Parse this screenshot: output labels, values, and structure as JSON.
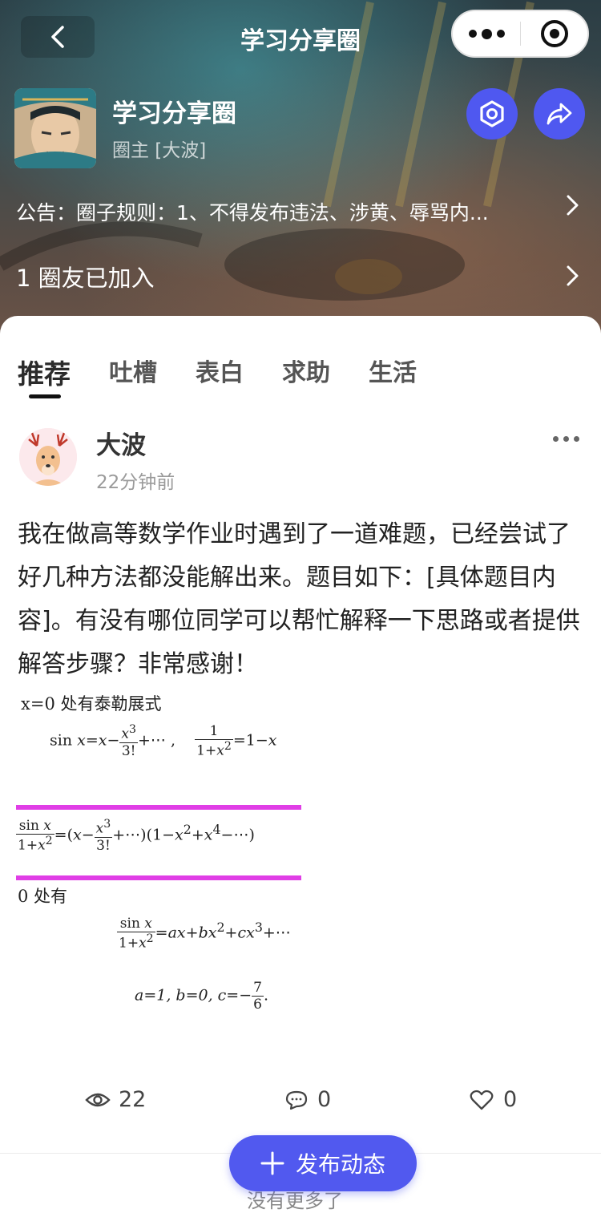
{
  "nav": {
    "title": "学习分享圈"
  },
  "circle": {
    "name": "学习分享圈",
    "owner": "圈主 [大波]",
    "notice": "公告：圈子规则：1、不得发布违法、涉黄、辱骂内...",
    "members": "1 圈友已加入"
  },
  "tabs": [
    {
      "label": "推荐",
      "active": true
    },
    {
      "label": "吐槽"
    },
    {
      "label": "表白"
    },
    {
      "label": "求助"
    },
    {
      "label": "生活"
    }
  ],
  "post": {
    "author": "大波",
    "time": "22分钟前",
    "text": "我在做高等数学作业时遇到了一道难题，已经尝试了好几种方法都没能解出来。题目如下：[具体题目内容]。有没有哪位同学可以帮忙解释一下思路或者提供解答步骤？非常感谢！",
    "math": {
      "line1": "x=0 处有泰勒展式",
      "line4": "0 处有",
      "result": "a=1, b=0, c=−"
    },
    "views": "22",
    "comments": "0",
    "likes": "0"
  },
  "fab": {
    "label": "发布动态"
  },
  "footer_hint": "没有更多了",
  "colors": {
    "accent": "#5159ef",
    "magenta": "#e03ee6"
  }
}
